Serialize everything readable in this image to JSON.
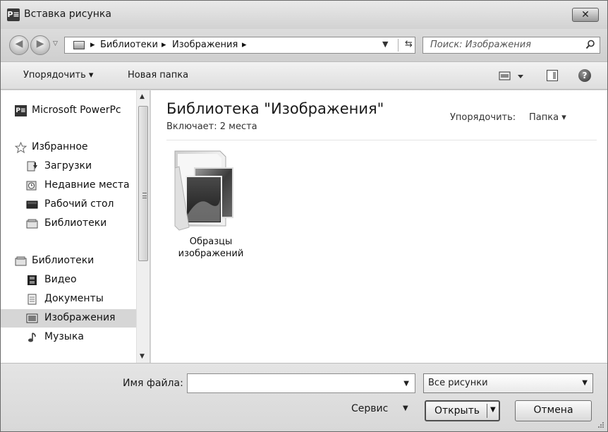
{
  "window": {
    "title": "Вставка рисунка",
    "app_icon_text": "P≡",
    "close_label": "✕"
  },
  "address": {
    "crumbs": [
      "Библиотеки",
      "Изображения"
    ],
    "search_placeholder": "Поиск: Изображения"
  },
  "toolbar": {
    "organize_label": "Упорядочить ▾",
    "new_folder_label": "Новая папка",
    "help_label": "?"
  },
  "sidebar": {
    "items": [
      {
        "label": "Microsoft PowerPc",
        "icon": "powerpoint-icon"
      },
      {
        "label": "Избранное",
        "icon": "star-icon"
      },
      {
        "label": "Загрузки",
        "icon": "downloads-icon"
      },
      {
        "label": "Недавние места",
        "icon": "recent-places-icon"
      },
      {
        "label": "Рабочий стол",
        "icon": "desktop-icon"
      },
      {
        "label": "Библиотеки",
        "icon": "libraries-icon"
      },
      {
        "label": "Библиотеки",
        "icon": "libraries-icon"
      },
      {
        "label": "Видео",
        "icon": "video-icon"
      },
      {
        "label": "Документы",
        "icon": "documents-icon"
      },
      {
        "label": "Изображения",
        "icon": "pictures-icon",
        "selected": true
      },
      {
        "label": "Музыка",
        "icon": "music-icon"
      }
    ]
  },
  "content": {
    "title": "Библиотека \"Изображения\"",
    "subtitle": "Включает: 2 места",
    "arrange_label": "Упорядочить:",
    "arrange_value": "Папка ▾",
    "folders": [
      {
        "label_line1": "Образцы",
        "label_line2": "изображений"
      }
    ]
  },
  "footer": {
    "filename_label": "Имя файла:",
    "filename_value": "",
    "filetype_value": "Все рисунки",
    "service_label": "Сервис",
    "open_label": "Открыть",
    "cancel_label": "Отмена"
  }
}
